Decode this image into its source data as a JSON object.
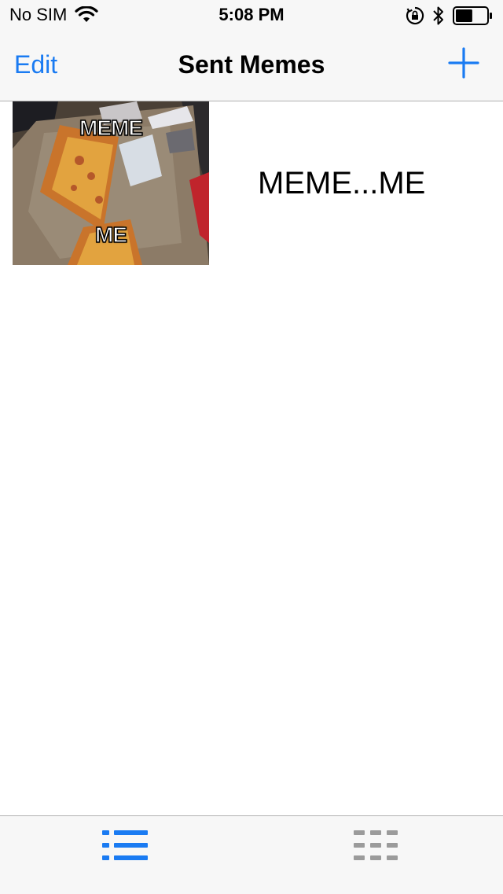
{
  "status_bar": {
    "carrier": "No SIM",
    "time": "5:08 PM",
    "battery_level": 0.55
  },
  "nav": {
    "edit_label": "Edit",
    "title": "Sent Memes",
    "add_icon": "plus-icon"
  },
  "memes": [
    {
      "top_text": "MEME",
      "bottom_text": "ME",
      "label": "MEME...ME"
    }
  ],
  "tabs": [
    {
      "icon": "list-icon",
      "selected": true
    },
    {
      "icon": "grid-icon",
      "selected": false
    }
  ],
  "colors": {
    "accent": "#1a7bf2",
    "inactive": "#9b9b9b",
    "bar_background": "#f7f7f7"
  }
}
